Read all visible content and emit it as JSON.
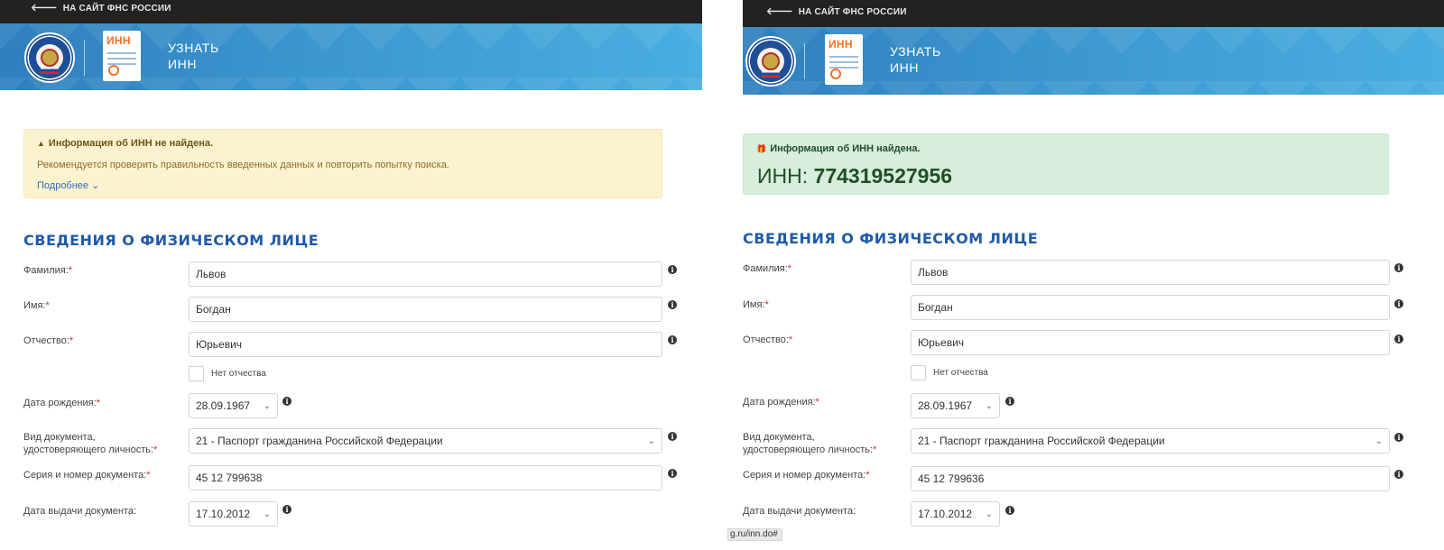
{
  "topbar": {
    "link_label": "НА САЙТ ФНС РОССИИ",
    "arrow_icon": "arrow-left-icon"
  },
  "banner": {
    "inn_doc_label": "ИНН",
    "title_line1": "УЗНАТЬ",
    "title_line2": "ИНН"
  },
  "left": {
    "alert": {
      "title": "Информация об ИНН не найдена.",
      "text": "Рекомендуется проверить правильность введенных данных и повторить попытку поиска.",
      "more_link": "Подробнее",
      "more_chevron": "⌄",
      "icon": "warning-icon",
      "icon_glyph": "▲"
    }
  },
  "right": {
    "alert": {
      "title": "Информация об ИНН найдена.",
      "inn_prefix": "ИНН: ",
      "inn_value": "774319527956",
      "icon": "gift-icon",
      "icon_glyph": "🎁"
    },
    "status_url": "g.ru/inn.do#"
  },
  "form": {
    "section_title": "СВЕДЕНИЯ О ФИЗИЧЕСКОМ ЛИЦЕ",
    "required_mark": "*",
    "labels": {
      "surname": "Фамилия:",
      "name": "Имя:",
      "patronymic": "Отчество:",
      "no_patronymic": "Нет отчества",
      "birth_date": "Дата рождения:",
      "doc_type_line1": "Вид документа,",
      "doc_type_line2": "удостоверяющего личность:",
      "doc_number": "Серия и номер документа:",
      "doc_issue_date": "Дата выдачи документа:"
    },
    "values": {
      "surname": "Львов",
      "name": "Богдан",
      "patronymic": "Юрьевич",
      "birth_date": "28.09.1967",
      "doc_type": "21 - Паспорт гражданина Российской Федерации",
      "doc_number_left": "45 12 799638",
      "doc_number_right": "45 12 799636",
      "doc_issue_date": "17.10.2012"
    },
    "select_chevron": "⌄",
    "info_glyph": "i"
  }
}
